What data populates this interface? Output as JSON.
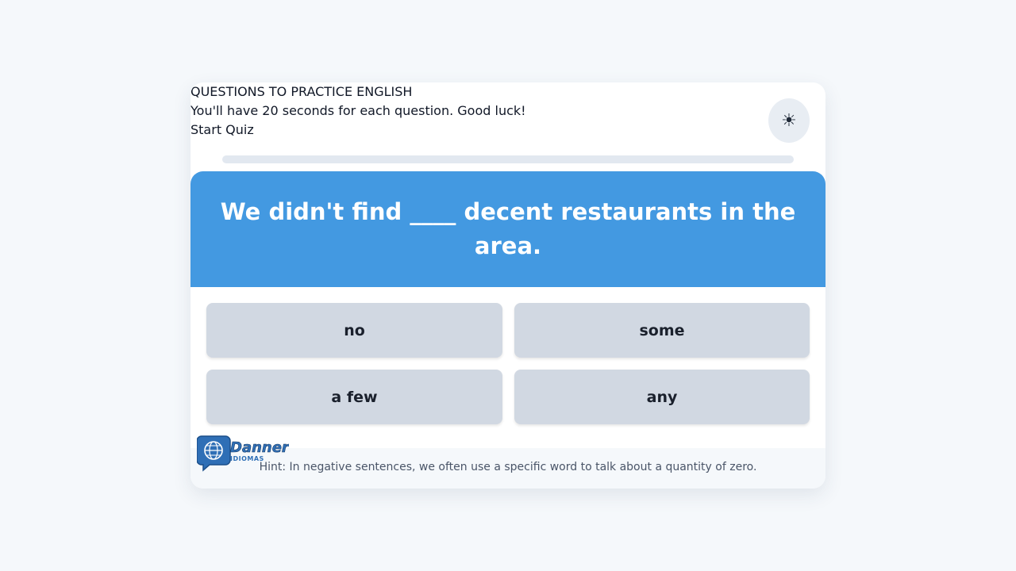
{
  "header": {
    "title": "QUESTIONS TO PRACTICE ENGLISH",
    "instructions": "You'll have 20 seconds for each question. Good luck!",
    "start_label": "Start Quiz"
  },
  "theme_toggle": {
    "icon": "sun-icon",
    "glyph": "☀"
  },
  "progress": {
    "fraction": 0
  },
  "question": {
    "text": "We didn't find ____ decent restaurants in the area."
  },
  "options": [
    "no",
    "some",
    "a few",
    "any"
  ],
  "hint": {
    "text": "Hint: In negative sentences, we often use a specific word to talk about a quantity of zero."
  },
  "logo": {
    "name": "Danner",
    "subtitle": "IDIOMAS"
  },
  "colors": {
    "accent": "#4399e1",
    "option_bg": "#d1d8e2",
    "page_bg": "#f5f8fb"
  }
}
